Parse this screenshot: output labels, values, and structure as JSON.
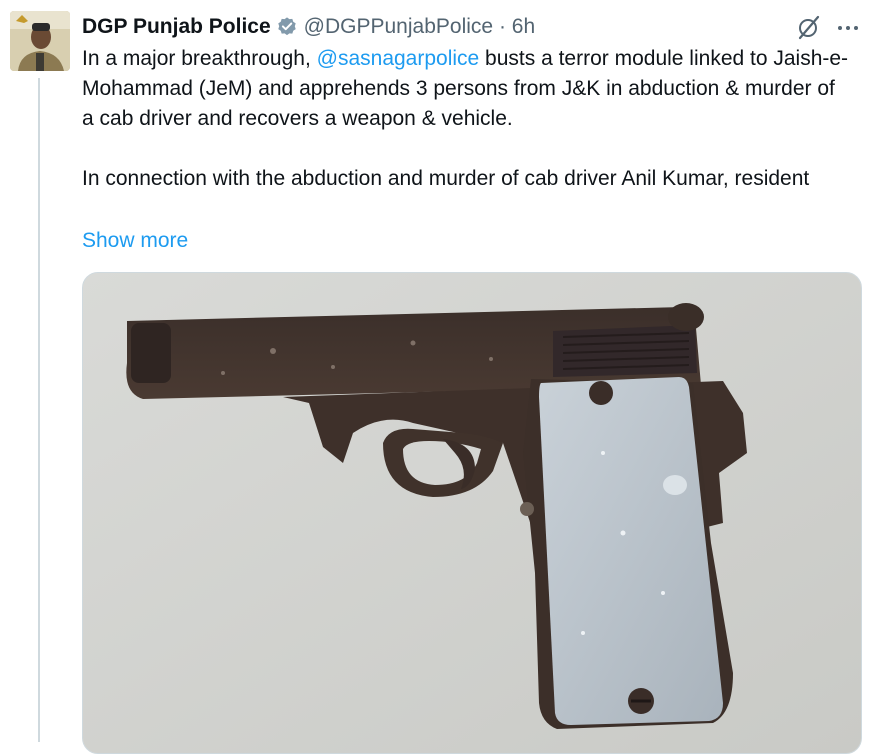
{
  "tweet": {
    "author": {
      "display_name": "DGP Punjab Police",
      "handle": "@DGPPunjabPolice",
      "separator": "·",
      "time": "6h",
      "verified_badge": "verified-check-icon"
    },
    "text": {
      "line1_before": "In a major breakthrough, ",
      "mention": "@sasnagarpolice",
      "line1_after": " busts a terror module linked to Jaish-e-Mohammad (JeM) and apprehends 3 persons from J&K in abduction & murder of a cab driver and recovers a weapon & vehicle.",
      "paragraph2": "In connection with the abduction and murder of cab driver Anil Kumar, resident"
    },
    "show_more": "Show more",
    "header_icons": [
      "grok-slash-icon",
      "more-dots-icon"
    ],
    "media": {
      "icon": "pistol-photo"
    }
  },
  "colors": {
    "link": "#1d9bf0",
    "text": "#0f1419",
    "secondary": "#536471",
    "border": "#cfd9de"
  }
}
